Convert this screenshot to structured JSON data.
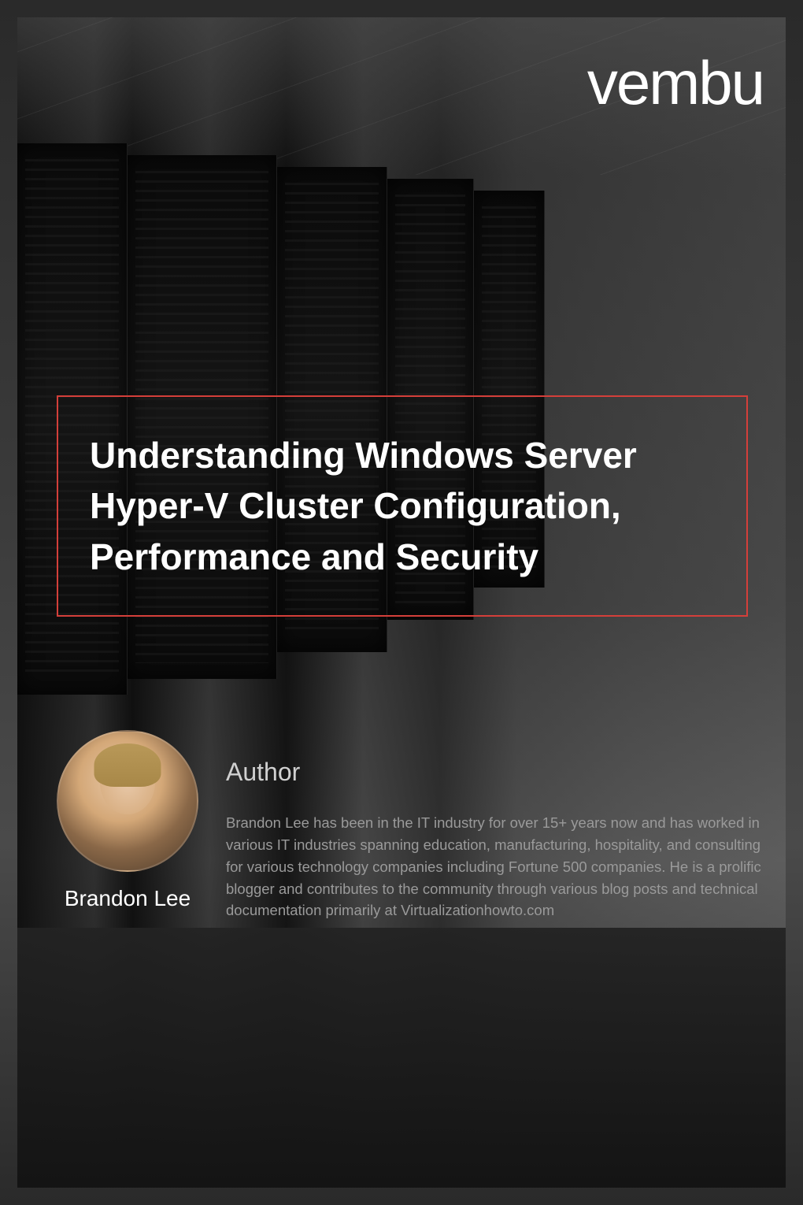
{
  "brand": {
    "logo_text": "vembu"
  },
  "document": {
    "title": "Understanding Windows Server Hyper-V Cluster Configuration, Performance and Security"
  },
  "author": {
    "label": "Author",
    "name": "Brandon Lee",
    "bio": "Brandon Lee has been in the IT industry for over 15+ years now and has worked in various IT industries spanning education, manufacturing, hospitality, and consulting for various technology companies including Fortune 500 companies. He is a prolific blogger and contributes to the community through various blog posts and technical documentation primarily at Virtualizationhowto.com"
  }
}
